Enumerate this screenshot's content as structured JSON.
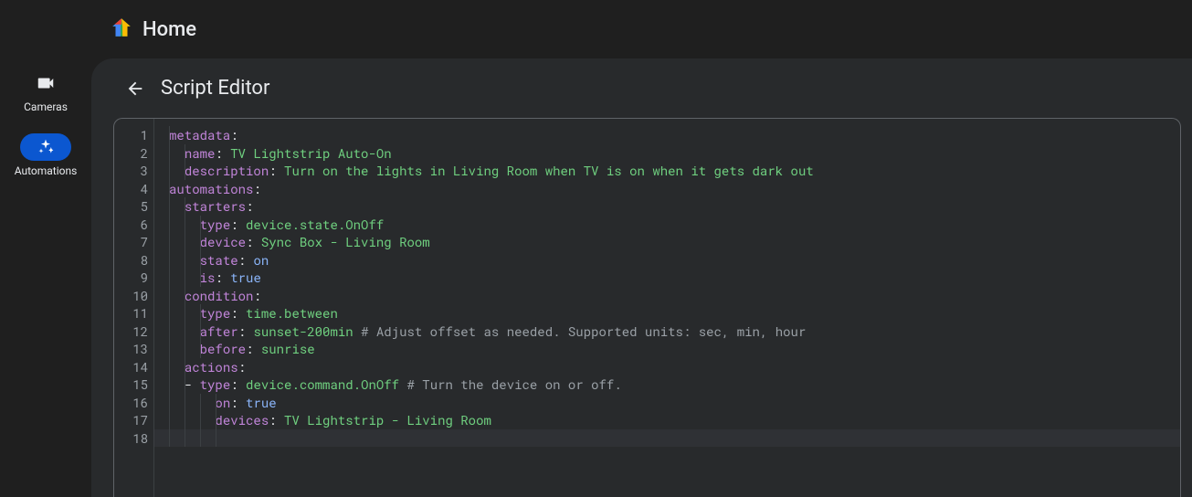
{
  "header": {
    "title": "Home"
  },
  "nav": {
    "items": [
      {
        "id": "cameras",
        "label": "Cameras",
        "icon": "camera-icon",
        "active": false
      },
      {
        "id": "automations",
        "label": "Automations",
        "icon": "sparkle-icon",
        "active": true
      }
    ]
  },
  "panel": {
    "title": "Script Editor"
  },
  "editor": {
    "line_count": 18,
    "current_line": 18,
    "lines": [
      {
        "n": 1,
        "indent": 0,
        "tokens": [
          [
            "k",
            "metadata"
          ],
          [
            "d",
            ":"
          ]
        ]
      },
      {
        "n": 2,
        "indent": 1,
        "tokens": [
          [
            "k",
            "name"
          ],
          [
            "d",
            ": "
          ],
          [
            "s",
            "TV Lightstrip Auto-On"
          ]
        ]
      },
      {
        "n": 3,
        "indent": 1,
        "tokens": [
          [
            "k",
            "description"
          ],
          [
            "d",
            ": "
          ],
          [
            "s",
            "Turn on the lights in Living Room when TV is on when it gets dark out"
          ]
        ]
      },
      {
        "n": 4,
        "indent": 0,
        "tokens": [
          [
            "k",
            "automations"
          ],
          [
            "d",
            ":"
          ]
        ]
      },
      {
        "n": 5,
        "indent": 1,
        "tokens": [
          [
            "k",
            "starters"
          ],
          [
            "d",
            ":"
          ]
        ]
      },
      {
        "n": 6,
        "indent": 2,
        "tokens": [
          [
            "k",
            "type"
          ],
          [
            "d",
            ": "
          ],
          [
            "s",
            "device.state.OnOff"
          ]
        ]
      },
      {
        "n": 7,
        "indent": 2,
        "tokens": [
          [
            "k",
            "device"
          ],
          [
            "d",
            ": "
          ],
          [
            "s",
            "Sync Box - Living Room"
          ]
        ]
      },
      {
        "n": 8,
        "indent": 2,
        "tokens": [
          [
            "k",
            "state"
          ],
          [
            "d",
            ": "
          ],
          [
            "b",
            "on"
          ]
        ]
      },
      {
        "n": 9,
        "indent": 2,
        "tokens": [
          [
            "k",
            "is"
          ],
          [
            "d",
            ": "
          ],
          [
            "b",
            "true"
          ]
        ]
      },
      {
        "n": 10,
        "indent": 1,
        "tokens": [
          [
            "k",
            "condition"
          ],
          [
            "d",
            ":"
          ]
        ]
      },
      {
        "n": 11,
        "indent": 2,
        "tokens": [
          [
            "k",
            "type"
          ],
          [
            "d",
            ": "
          ],
          [
            "s",
            "time.between"
          ]
        ]
      },
      {
        "n": 12,
        "indent": 2,
        "tokens": [
          [
            "k",
            "after"
          ],
          [
            "d",
            ": "
          ],
          [
            "s",
            "sunset-200min"
          ],
          [
            "d",
            " "
          ],
          [
            "c",
            "# Adjust offset as needed. Supported units: sec, min, hour"
          ]
        ]
      },
      {
        "n": 13,
        "indent": 2,
        "tokens": [
          [
            "k",
            "before"
          ],
          [
            "d",
            ": "
          ],
          [
            "s",
            "sunrise"
          ]
        ]
      },
      {
        "n": 14,
        "indent": 1,
        "tokens": [
          [
            "k",
            "actions"
          ],
          [
            "d",
            ":"
          ]
        ]
      },
      {
        "n": 15,
        "indent": 1,
        "tokens": [
          [
            "dash",
            "- "
          ],
          [
            "k",
            "type"
          ],
          [
            "d",
            ": "
          ],
          [
            "s",
            "device.command.OnOff"
          ],
          [
            "d",
            " "
          ],
          [
            "c",
            "# Turn the device on or off."
          ]
        ]
      },
      {
        "n": 16,
        "indent": 3,
        "tokens": [
          [
            "k",
            "on"
          ],
          [
            "d",
            ": "
          ],
          [
            "b",
            "true"
          ]
        ]
      },
      {
        "n": 17,
        "indent": 3,
        "tokens": [
          [
            "k",
            "devices"
          ],
          [
            "d",
            ": "
          ],
          [
            "s",
            "TV Lightstrip - Living Room"
          ]
        ]
      },
      {
        "n": 18,
        "indent": 3,
        "tokens": []
      }
    ]
  }
}
